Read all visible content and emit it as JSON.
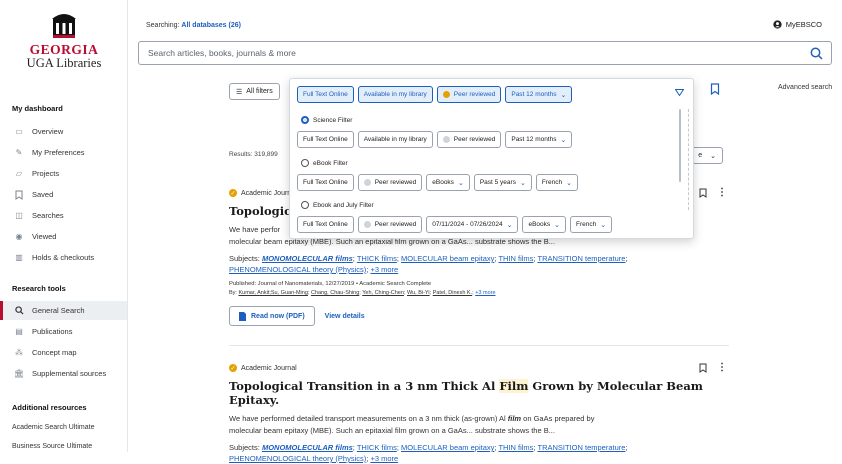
{
  "sidebar": {
    "logo_line1": "GEORGIA",
    "logo_line2": "UGA Libraries",
    "dashboard_title": "My dashboard",
    "dashboard_items": [
      {
        "label": "Overview",
        "icon": "overview-icon"
      },
      {
        "label": "My Preferences",
        "icon": "preferences-icon"
      },
      {
        "label": "Projects",
        "icon": "projects-icon"
      },
      {
        "label": "Saved",
        "icon": "bookmark-icon"
      },
      {
        "label": "Searches",
        "icon": "searches-icon"
      },
      {
        "label": "Viewed",
        "icon": "eye-icon"
      },
      {
        "label": "Holds & checkouts",
        "icon": "books-icon"
      }
    ],
    "research_title": "Research tools",
    "research_items": [
      {
        "label": "General Search",
        "icon": "search-icon"
      },
      {
        "label": "Publications",
        "icon": "publications-icon"
      },
      {
        "label": "Concept map",
        "icon": "concept-map-icon"
      },
      {
        "label": "Supplemental sources",
        "icon": "institution-icon"
      }
    ],
    "additional_title": "Additional resources",
    "additional_items": [
      "Academic Search Ultimate",
      "Business Source Ultimate"
    ]
  },
  "header": {
    "searching_prefix": "Searching:",
    "searching_db": "All databases (26)",
    "account_label": "MyEBSCO"
  },
  "search": {
    "placeholder": "Search articles, books, journals & more"
  },
  "toolbar": {
    "all_filters": "All filters",
    "advanced_search": "Advanced search",
    "results_count": "Results: 319,899"
  },
  "popup": {
    "top_chips": [
      "Full Text Online",
      "Available in my library",
      "Peer reviewed",
      "Past 12 months"
    ],
    "groups": [
      {
        "name": "Science Filter",
        "selected": true,
        "chips": [
          "Full Text Online",
          "Available in my library",
          "Peer reviewed",
          "Past 12 months"
        ]
      },
      {
        "name": "eBook Filter",
        "selected": false,
        "chips": [
          "Full Text Online",
          "Peer reviewed",
          "eBooks",
          "Past 5 years",
          "French"
        ]
      },
      {
        "name": "Ebook and July Filter",
        "selected": false,
        "chips": [
          "Full Text Online",
          "Peer reviewed",
          "07/11/2024 - 07/26/2024",
          "eBooks",
          "French"
        ]
      }
    ]
  },
  "results": [
    {
      "type": "Academic Journal",
      "title_visible": "Topological",
      "abstract_line1": "We have perfor",
      "abstract_line2": "molecular beam epitaxy (MBE). Such an epitaxial film grown on a GaAs... substrate shows the B...",
      "subjects_label": "Subjects:",
      "subjects": [
        "MONOMOLECULAR films",
        "THICK films",
        "MOLECULAR beam epitaxy",
        "THIN films",
        "TRANSITION temperature",
        "PHENOMENOLOGICAL theory (Physics)"
      ],
      "subjects_more": "+3 more",
      "published": "Published: Journal of Nanomaterials, 12/27/2019 • Academic Search Complete",
      "by_label": "By:",
      "authors": [
        "Kumar, Ankit;Su, Guan-Ming",
        "Chang, Chau-Shing",
        "Yeh, Ching-Chen",
        "Wu, Bi-Yi",
        "Patel, Dinesh K."
      ],
      "authors_more": "+3 more",
      "read_now": "Read now (PDF)",
      "view_details": "View details"
    },
    {
      "type": "Academic Journal",
      "title_before": "Topological Transition in a 3 nm Thick Al ",
      "title_highlight": "Film",
      "title_after": " Grown by Molecular Beam Epitaxy.",
      "abstract_line1_before": "We have performed detailed transport measurements on a 3 nm thick (as-grown) Al ",
      "abstract_line1_em": "film",
      "abstract_line1_after": " on GaAs prepared by",
      "abstract_line2": "molecular beam epitaxy (MBE). Such an epitaxial film grown on a GaAs... substrate shows the B...",
      "subjects_label": "Subjects:",
      "subjects_more": "+3 more"
    }
  ],
  "colors": {
    "brand_red": "#ba0c2f",
    "link_blue": "#1d5fbf",
    "peer_review_gold": "#e5a100"
  }
}
